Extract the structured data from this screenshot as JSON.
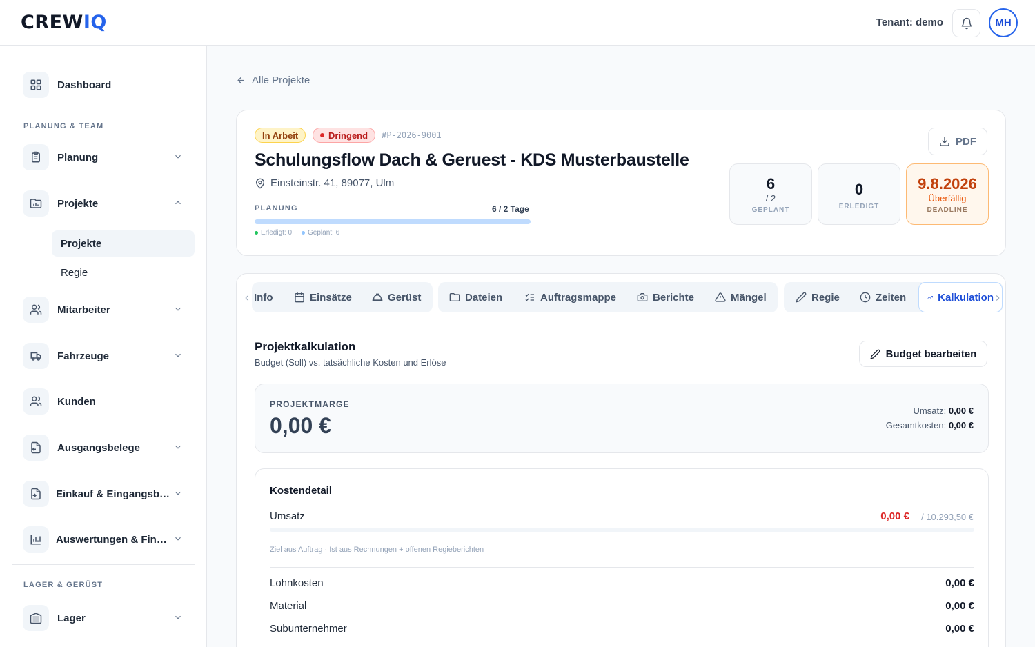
{
  "app": {
    "logo_main": "CREW",
    "logo_accent": "IQ",
    "tenant": "Tenant: demo",
    "avatar_initials": "MH"
  },
  "sidebar": {
    "dashboard": "Dashboard",
    "section_planung": "PLANUNG & TEAM",
    "planung": "Planung",
    "projekte": "Projekte",
    "sub_projekte": "Projekte",
    "sub_regie": "Regie",
    "mitarbeiter": "Mitarbeiter",
    "fahrzeuge": "Fahrzeuge",
    "kunden": "Kunden",
    "ausgangsbelege": "Ausgangsbelege",
    "einkauf": "Einkauf & Eingangsbelege",
    "auswertungen": "Auswertungen & Finanzen",
    "section_lager": "LAGER & GERÜST",
    "lager": "Lager"
  },
  "back_link": "Alle Projekte",
  "project": {
    "status": "In Arbeit",
    "priority": "Dringend",
    "number": "#P-2026-9001",
    "title": "Schulungsflow Dach & Geruest - KDS Musterbaustelle",
    "address": "Einsteinstr. 41, 89077, Ulm",
    "planning_label": "PLANUNG",
    "planning_days": "6 / 2 Tage",
    "planning_done_fraction": 0,
    "legend_done": "Erledigt: 0",
    "legend_planned": "Geplant: 6",
    "pdf_label": "PDF",
    "stats": [
      {
        "big": "6",
        "sub": "/ 2",
        "cap": "GEPLANT"
      },
      {
        "big": "0",
        "sub": "",
        "cap": "ERLEDIGT"
      },
      {
        "big": "9.8.2026",
        "sub": "Überfällig",
        "cap": "DEADLINE"
      }
    ]
  },
  "tabs": [
    "Info",
    "Einsätze",
    "Gerüst",
    "Dateien",
    "Auftragsmappe",
    "Berichte",
    "Mängel",
    "Regie",
    "Zeiten",
    "Kalkulation"
  ],
  "active_tab": "Kalkulation",
  "calc": {
    "title": "Projektkalkulation",
    "subtitle": "Budget (Soll) vs. tatsächliche Kosten und Erlöse",
    "edit_button": "Budget bearbeiten",
    "margin_label": "PROJEKTMARGE",
    "margin_value": "0,00 €",
    "umsatz_label": "Umsatz:",
    "umsatz_value": "0,00 €",
    "gesamtkosten_label": "Gesamtkosten:",
    "gesamtkosten_value": "0,00 €",
    "detail_title": "Kostendetail",
    "revenue_label": "Umsatz",
    "revenue_actual": "0,00 €",
    "revenue_target": "/ 10.293,50 €",
    "revenue_progress": 0,
    "revenue_note": "Ziel aus Auftrag · Ist aus Rechnungen + offenen Regieberichten",
    "rows": [
      {
        "label": "Lohnkosten",
        "value": "0,00 €"
      },
      {
        "label": "Material",
        "value": "0,00 €"
      },
      {
        "label": "Subunternehmer",
        "value": "0,00 €"
      }
    ]
  },
  "colors": {
    "accent": "#2563eb",
    "danger": "#dc2626",
    "warning": "#c2410c"
  }
}
